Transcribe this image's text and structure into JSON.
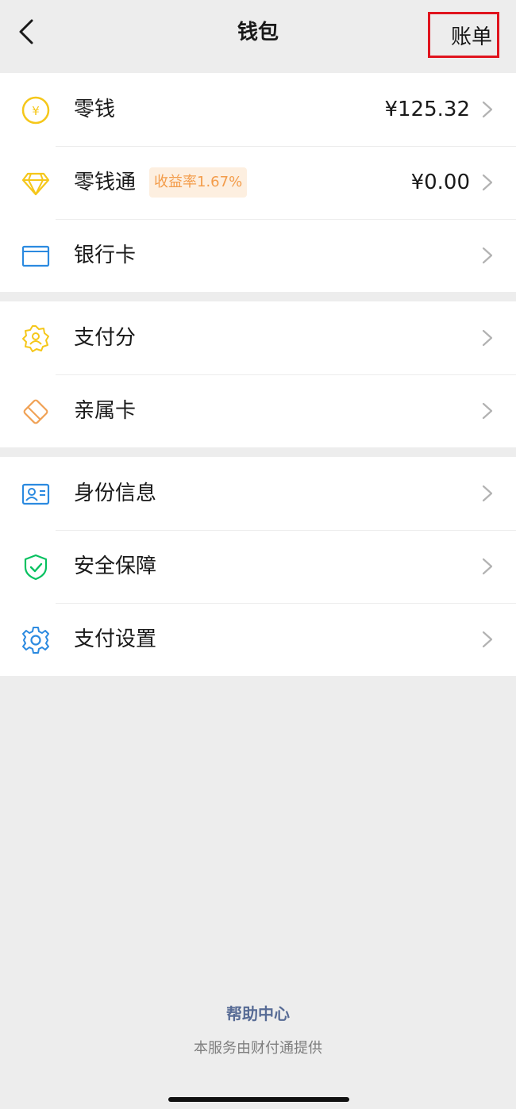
{
  "navbar": {
    "back_icon": "chevron-left-icon",
    "title": "钱包",
    "bill_label": "账单"
  },
  "groups": [
    {
      "items": [
        {
          "label": "零钱",
          "value": "¥125.32",
          "icon": "yuan-coin-icon",
          "icon_color": "#f5c71a"
        },
        {
          "label": "零钱通",
          "badge": "收益率1.67%",
          "value": "¥0.00",
          "icon": "diamond-icon",
          "icon_color": "#f5c71a"
        },
        {
          "label": "银行卡",
          "icon": "bank-card-icon",
          "icon_color": "#2b8ae0"
        }
      ]
    },
    {
      "items": [
        {
          "label": "支付分",
          "icon": "pay-score-badge-icon",
          "icon_color": "#f5c71a"
        },
        {
          "label": "亲属卡",
          "icon": "family-card-icon",
          "icon_color": "#f0a154"
        }
      ]
    },
    {
      "items": [
        {
          "label": "身份信息",
          "icon": "id-card-icon",
          "icon_color": "#2b8ae0"
        },
        {
          "label": "安全保障",
          "icon": "shield-check-icon",
          "icon_color": "#07c160"
        },
        {
          "label": "支付设置",
          "icon": "gear-icon",
          "icon_color": "#2b8ae0"
        }
      ]
    }
  ],
  "footer": {
    "help_label": "帮助中心",
    "provider_note": "本服务由财付通提供"
  },
  "colors": {
    "background": "#ededed",
    "link": "#576b95",
    "highlight_border": "#e0141e",
    "badge_text": "#f39c4a",
    "badge_bg": "#fdefe0"
  }
}
